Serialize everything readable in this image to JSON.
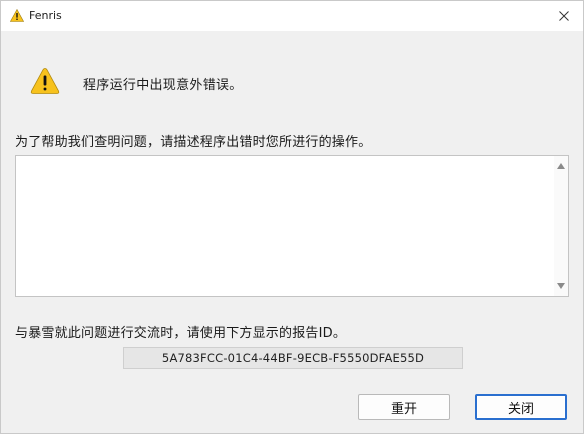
{
  "window": {
    "title": "Fenris"
  },
  "dialog": {
    "error_message": "程序运行中出现意外错误。",
    "help_prompt": "为了帮助我们查明问题，请描述程序出错时您所进行的操作。",
    "description_value": "",
    "exchange_prompt": "与暴雪就此问题进行交流时，请使用下方显示的报告ID。",
    "report_id": "5A783FCC-01C4-44BF-9ECB-F5550DFAE55D"
  },
  "buttons": {
    "restart_label": "重开",
    "close_label": "关闭"
  },
  "colors": {
    "warning_fill": "#f7c21d",
    "focus_border": "#2a6fcf"
  }
}
